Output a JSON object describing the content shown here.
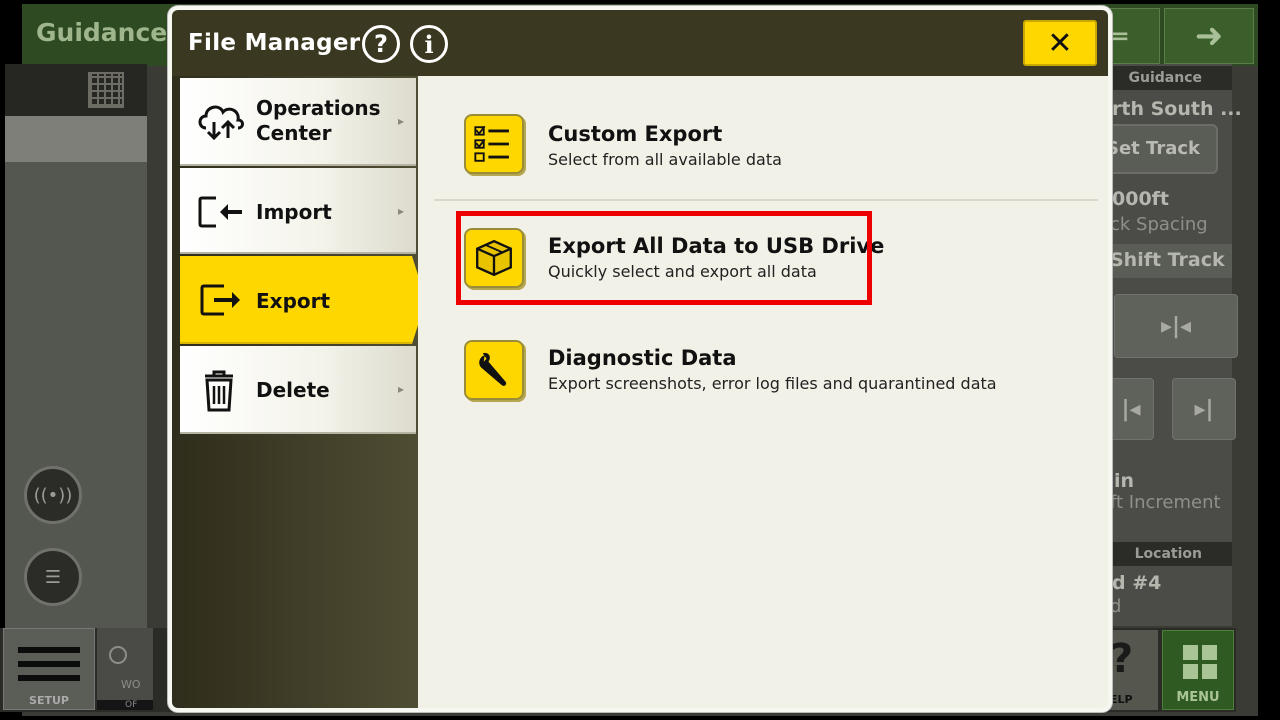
{
  "background": {
    "title": "Guidance",
    "nav_back": "⇐",
    "nav_forward": "➜",
    "guidance_header": "Guidance",
    "track_name": "rth South ...",
    "set_track": "Set Track",
    "spacing_value": "000ft",
    "spacing_label": "ck Spacing",
    "shift_track": "Shift Track",
    "increment_value": "in",
    "increment_label": "ft Increment",
    "location_header": "Location",
    "location_value": "d #4",
    "location_sub": "d",
    "setup_label": "SETUP",
    "work_label": "WO",
    "work_bar": "OF",
    "help_label": "ELP",
    "menu_label": "MENU"
  },
  "modal": {
    "title": "File Manager",
    "help_icon": "?",
    "info_icon": "i",
    "close_icon": "✕"
  },
  "sidebar": {
    "items": [
      {
        "label_line1": "Operations",
        "label_line2": "Center",
        "icon": "cloud-sync-icon"
      },
      {
        "label": "Import",
        "icon": "import-icon"
      },
      {
        "label": "Export",
        "icon": "export-icon",
        "active": true
      },
      {
        "label": "Delete",
        "icon": "trash-icon"
      }
    ],
    "arrow": "▸"
  },
  "options": [
    {
      "title": "Custom Export",
      "subtitle": "Select from all available data",
      "icon": "checklist-icon"
    },
    {
      "title": "Export All Data to USB Drive",
      "subtitle": "Quickly select and export all data",
      "icon": "box-icon",
      "highlighted": true
    },
    {
      "title": "Diagnostic Data",
      "subtitle": "Export screenshots, error log files and quarantined data",
      "icon": "wrench-icon"
    }
  ],
  "colors": {
    "accent": "#ffd700",
    "header": "#3a3820",
    "highlight": "#ee0000"
  }
}
